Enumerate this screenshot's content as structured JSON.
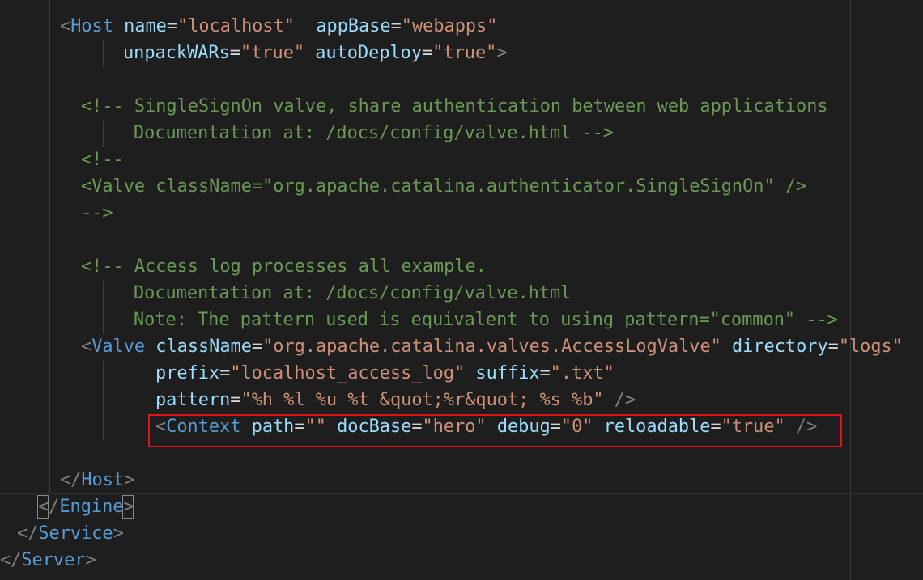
{
  "editor": {
    "language": "xml",
    "colors": {
      "background": "#1e1e1e",
      "bracket": "#808080",
      "tag": "#569cd6",
      "attribute": "#9cdcfe",
      "string": "#ce9178",
      "comment": "#6a9955",
      "highlight_box": "#e0151a"
    },
    "lines": [
      "<Host name=\"localhost\"  appBase=\"webapps\"",
      "unpackWARs=\"true\" autoDeploy=\"true\">",
      "",
      "<!-- SingleSignOn valve, share authentication between web applications",
      "Documentation at: /docs/config/valve.html -->",
      "<!--",
      "<Valve className=\"org.apache.catalina.authenticator.SingleSignOn\" />",
      "-->",
      "",
      "<!-- Access log processes all example.",
      "Documentation at: /docs/config/valve.html",
      "Note: The pattern used is equivalent to using pattern=\"common\" -->",
      "<Valve className=\"org.apache.catalina.valves.AccessLogValve\" directory=\"logs\"",
      "prefix=\"localhost_access_log\" suffix=\".txt\"",
      "pattern=\"%h %l %u %t &quot;%r&quot; %s %b\" />",
      "<Context path=\"\" docBase=\"hero\" debug=\"0\" reloadable=\"true\" />",
      "",
      "</Host>",
      "</Engine>",
      "</Service>",
      "</Server>"
    ],
    "highlighted_line": 15
  }
}
